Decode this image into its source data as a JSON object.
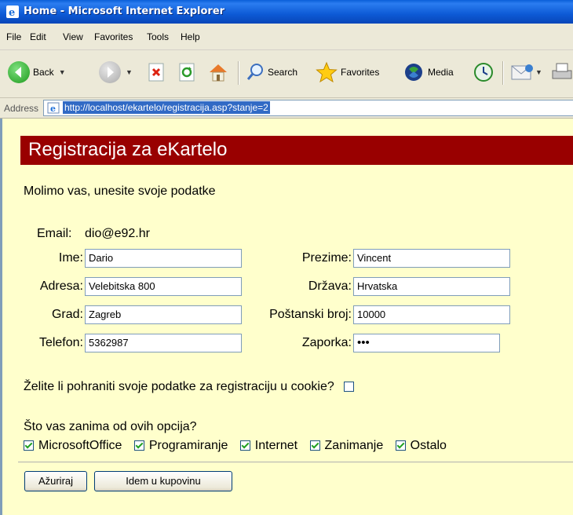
{
  "window": {
    "title": "Home - Microsoft Internet Explorer"
  },
  "menu": [
    "File",
    "Edit",
    "View",
    "Favorites",
    "Tools",
    "Help"
  ],
  "toolbar": {
    "back": "Back",
    "search": "Search",
    "favorites": "Favorites",
    "media": "Media"
  },
  "address": {
    "label": "Address",
    "url": "http://localhost/ekartelo/registracija.asp?stanje=2"
  },
  "page": {
    "heading": "Registracija za eKartelo",
    "intro": "Molimo vas, unesite svoje podatke",
    "email_label": "Email:",
    "email_value": "dio@e92.hr",
    "fields": {
      "ime_label": "Ime:",
      "ime_value": "Dario",
      "prezime_label": "Prezime:",
      "prezime_value": "Vincent",
      "adresa_label": "Adresa:",
      "adresa_value": "Velebitska 800",
      "drzava_label": "Država:",
      "drzava_value": "Hrvatska",
      "grad_label": "Grad:",
      "grad_value": "Zagreb",
      "postanski_label": "Poštanski broj:",
      "postanski_value": "10000",
      "telefon_label": "Telefon:",
      "telefon_value": "5362987",
      "zaporka_label": "Zaporka:",
      "zaporka_value": "•••"
    },
    "cookie_question": "Želite li pohraniti svoje podatke za registraciju u cookie?",
    "options_question": "Što vas zanima od ovih opcija?",
    "options": [
      "MicrosoftOffice",
      "Programiranje",
      "Internet",
      "Zanimanje",
      "Ostalo"
    ],
    "buttons": {
      "update": "Ažuriraj",
      "shop": "Idem u kupovinu"
    }
  },
  "colors": {
    "header_bg": "#990000",
    "page_bg": "#ffffcc",
    "titlebar": "#0a5fd8"
  }
}
